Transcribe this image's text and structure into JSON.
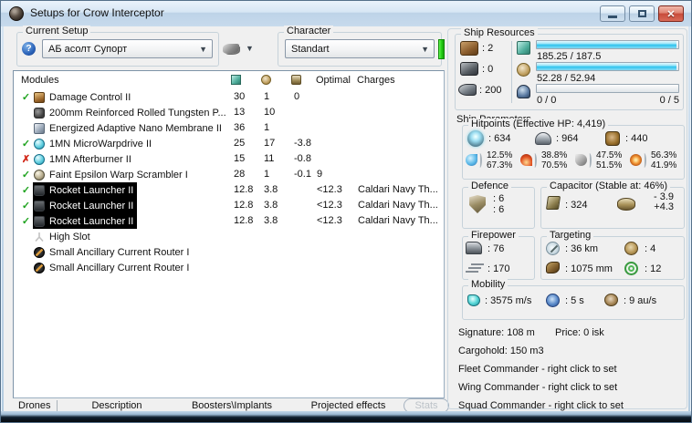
{
  "window": {
    "title": "Setups for Crow Interceptor",
    "close_glyph": "✕"
  },
  "setup": {
    "label": "Current Setup",
    "value": "АБ асолт Супорт",
    "help_glyph": "?",
    "arrow_glyph": "▼"
  },
  "character": {
    "label": "Character",
    "value": "Standart"
  },
  "modules": {
    "header": {
      "title": "Modules",
      "optimal": "Optimal",
      "charges": "Charges"
    },
    "rows": [
      {
        "mark": "✓",
        "name": "Damage Control II",
        "cpu": "30",
        "pg": "1",
        "cap": "0",
        "optimal": "",
        "charges": ""
      },
      {
        "mark": "",
        "name": "200mm Reinforced Rolled Tungsten P...",
        "cpu": "13",
        "pg": "10",
        "cap": "",
        "optimal": "",
        "charges": ""
      },
      {
        "mark": "",
        "name": "Energized Adaptive Nano Membrane II",
        "cpu": "36",
        "pg": "1",
        "cap": "",
        "optimal": "",
        "charges": ""
      },
      {
        "mark": "✓",
        "name": "1MN MicroWarpdrive II",
        "cpu": "25",
        "pg": "17",
        "cap": "-3.8",
        "optimal": "",
        "charges": ""
      },
      {
        "mark": "✗",
        "name": "1MN Afterburner II",
        "cpu": "15",
        "pg": "11",
        "cap": "-0.8",
        "optimal": "",
        "charges": ""
      },
      {
        "mark": "✓",
        "name": "Faint Epsilon Warp Scrambler I",
        "cpu": "28",
        "pg": "1",
        "cap": "-0.1",
        "optimal": "9",
        "charges": ""
      },
      {
        "mark": "✓",
        "name": "Rocket Launcher II",
        "cpu": "12.8",
        "pg": "3.8",
        "cap": "",
        "optimal": "<12.3",
        "charges": "Caldari Navy Th..."
      },
      {
        "mark": "✓",
        "name": "Rocket Launcher II",
        "cpu": "12.8",
        "pg": "3.8",
        "cap": "",
        "optimal": "<12.3",
        "charges": "Caldari Navy Th..."
      },
      {
        "mark": "✓",
        "name": "Rocket Launcher II",
        "cpu": "12.8",
        "pg": "3.8",
        "cap": "",
        "optimal": "<12.3",
        "charges": "Caldari Navy Th..."
      },
      {
        "mark": "",
        "name": "High Slot",
        "cpu": "",
        "pg": "",
        "cap": "",
        "optimal": "",
        "charges": ""
      },
      {
        "mark": "",
        "name": "Small Ancillary Current Router I",
        "cpu": "",
        "pg": "",
        "cap": "",
        "optimal": "",
        "charges": ""
      },
      {
        "mark": "",
        "name": "Small Ancillary Current Router I",
        "cpu": "",
        "pg": "",
        "cap": "",
        "optimal": "",
        "charges": ""
      }
    ]
  },
  "tabs": {
    "drones": "Drones",
    "description": "Description",
    "boosters": "Boosters\\Implants",
    "projected": "Projected effects",
    "stats": "Stats"
  },
  "resources": {
    "label": "Ship Resources",
    "turret_hardpoints": ": 2",
    "launcher_hardpoints": ": 0",
    "calibration": ": 200",
    "cpu_text": "185.25 / 187.5",
    "cpu_pct": 98.8,
    "pg_text": "52.28 / 52.94",
    "pg_pct": 98.8,
    "drone_text": "0 / 0",
    "drone_right": "0 / 5",
    "drone_pct": 0
  },
  "parameters": {
    "label": "Ship Parameters",
    "hitpoints": {
      "label": "Hitpoints (Effective HP: 4,419)",
      "shield": ": 634",
      "armor": ": 964",
      "structure": ": 440",
      "resists": {
        "em_top": "12.5%",
        "em_bottom": "67.3%",
        "thermal_top": "38.8%",
        "thermal_bottom": "70.5%",
        "kinetic_top": "47.5%",
        "kinetic_bottom": "51.5%",
        "explosive_top": "56.3%",
        "explosive_bottom": "41.9%"
      }
    },
    "defence": {
      "label": "Defence",
      "value1": ": 6",
      "value2": ": 6"
    },
    "capacitor": {
      "label": "Capacitor (Stable at: 46%)",
      "amount": ": 324",
      "delta_minus": "- 3.9",
      "delta_plus": "+4.3"
    },
    "firepower": {
      "label": "Firepower",
      "turret": ": 76",
      "missile": ": 170"
    },
    "targeting": {
      "label": "Targeting",
      "range": ": 36 km",
      "scan_res": ": 1075 mm",
      "max_targets": ": 4",
      "sensor_strength": ": 12"
    },
    "mobility": {
      "label": "Mobility",
      "speed": ": 3575 m/s",
      "align_time": ": 5 s",
      "warp_speed": ": 9 au/s"
    }
  },
  "footer": {
    "signature": "Signature: 108 m",
    "price": "Price: 0 isk",
    "cargohold": "Cargohold: 150 m3",
    "fleet": "Fleet Commander - right click to set",
    "wing": "Wing Commander - right click to set",
    "squad": "Squad Commander - right click to set"
  },
  "colors": {
    "bar_fill": "#2fc3ee",
    "indicator_green": "#22ce12",
    "check_green": "#1fa31f",
    "cross_red": "#d22718",
    "selection_bg": "#000000"
  }
}
